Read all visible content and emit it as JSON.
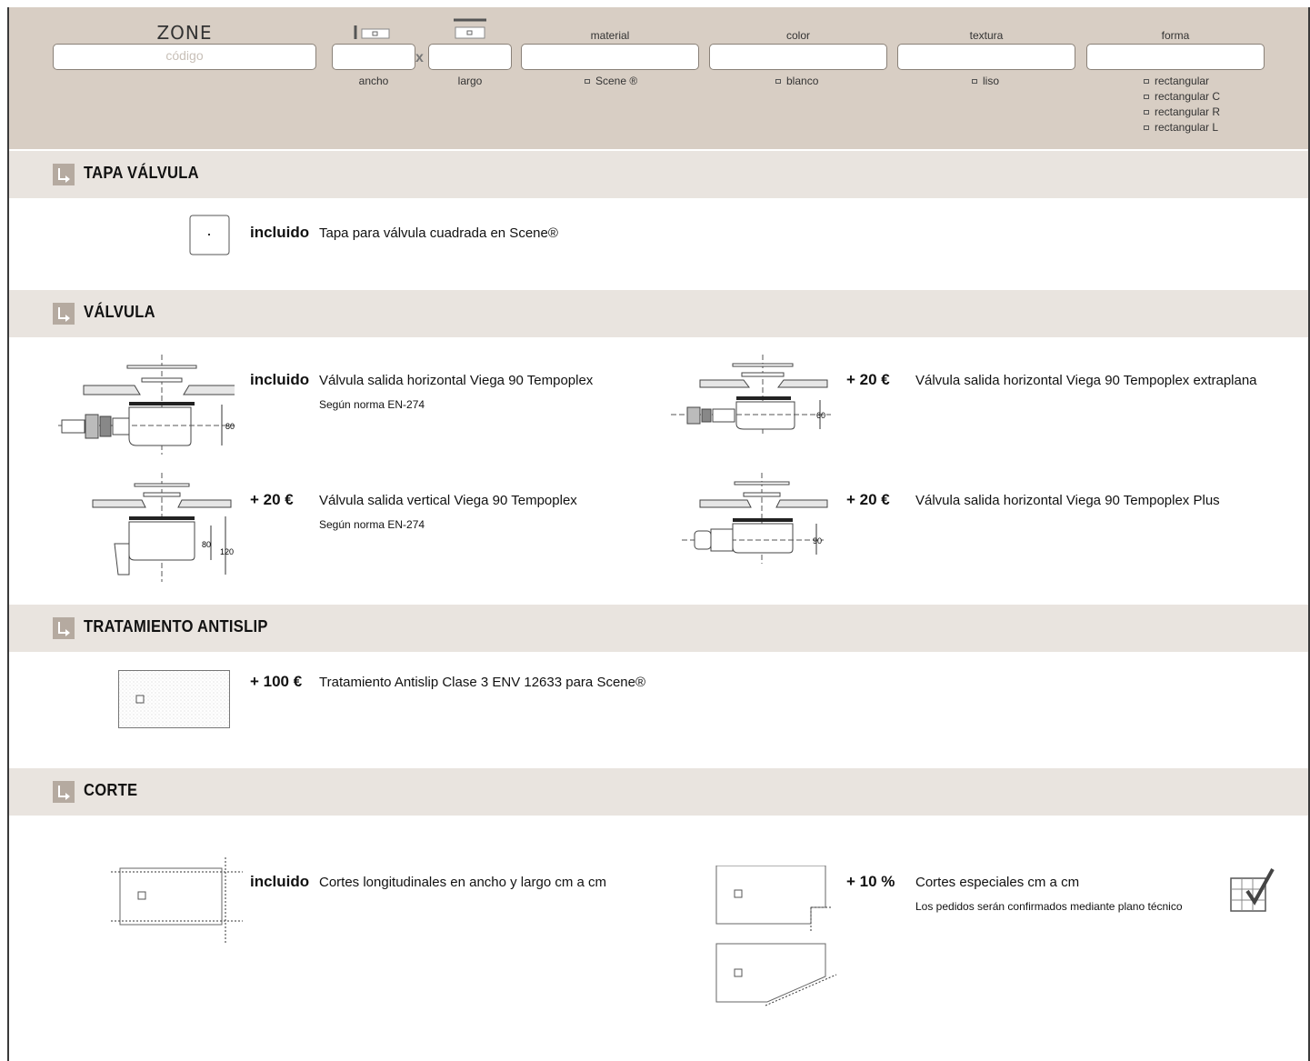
{
  "header": {
    "zone_title": "ZONE",
    "codigo_placeholder": "código",
    "multiply": "x",
    "ancho_label": "ancho",
    "largo_label": "largo",
    "material_label": "material",
    "color_label": "color",
    "textura_label": "textura",
    "forma_label": "forma",
    "material_options": [
      "Scene ®"
    ],
    "color_options": [
      "blanco"
    ],
    "textura_options": [
      "liso"
    ],
    "forma_options": [
      "rectangular",
      "rectangular C",
      "rectangular R",
      "rectangular L"
    ]
  },
  "sections": {
    "tapa": {
      "title": "TAPA VÁLVULA",
      "items": [
        {
          "price": "incluido",
          "desc": "Tapa para válvula cuadrada en Scene®"
        }
      ]
    },
    "valvula": {
      "title": "VÁLVULA",
      "items": [
        {
          "price": "incluido",
          "desc": "Válvula salida horizontal Viega 90 Tempoplex",
          "sub": "Según norma EN-274",
          "dim": "80"
        },
        {
          "price": "+ 20 €",
          "desc": "Válvula salida horizontal Viega 90 Tempoplex extraplana",
          "dim": "60"
        },
        {
          "price": "+ 20 €",
          "desc": "Válvula salida vertical Viega 90 Tempoplex",
          "sub": "Según norma EN-274",
          "dim_a": "80",
          "dim_b": "120"
        },
        {
          "price": "+ 20 €",
          "desc": "Válvula salida horizontal Viega 90 Tempoplex Plus",
          "dim": "90"
        }
      ]
    },
    "antislip": {
      "title": "TRATAMIENTO ANTISLIP",
      "items": [
        {
          "price": "+ 100 €",
          "desc": "Tratamiento Antislip Clase 3 ENV 12633 para Scene®"
        }
      ]
    },
    "corte": {
      "title": "CORTE",
      "items": [
        {
          "price": "incluido",
          "desc": "Cortes longitudinales en ancho y largo cm a cm"
        },
        {
          "price": "+ 10 %",
          "desc": "Cortes especiales cm a cm",
          "sub": "Los pedidos serán confirmados mediante plano técnico"
        }
      ]
    }
  }
}
